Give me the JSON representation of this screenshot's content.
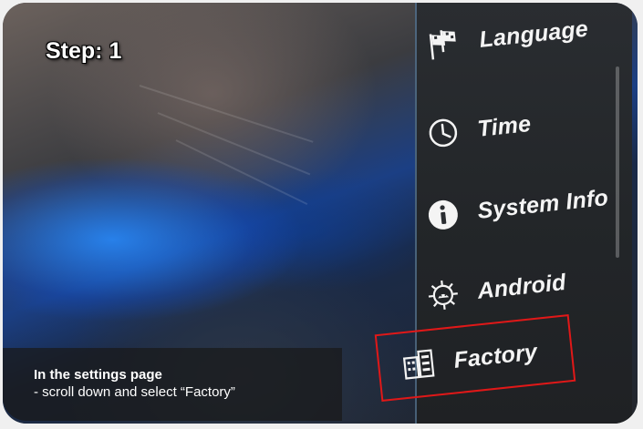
{
  "step": {
    "label": "Step: 1"
  },
  "menu": {
    "items": [
      {
        "label": "Language",
        "icon": "flags-icon"
      },
      {
        "label": "Time",
        "icon": "clock-icon"
      },
      {
        "label": "System Info",
        "icon": "info-icon"
      },
      {
        "label": "Android",
        "icon": "android-gear-icon"
      },
      {
        "label": "Factory",
        "icon": "factory-icon"
      }
    ],
    "highlighted": "Factory"
  },
  "caption": {
    "title": "In the settings page",
    "body": "- scroll down and select “Factory”"
  },
  "colors": {
    "highlight": "#e01818",
    "text": "#ffffff",
    "panel": "#232629"
  }
}
